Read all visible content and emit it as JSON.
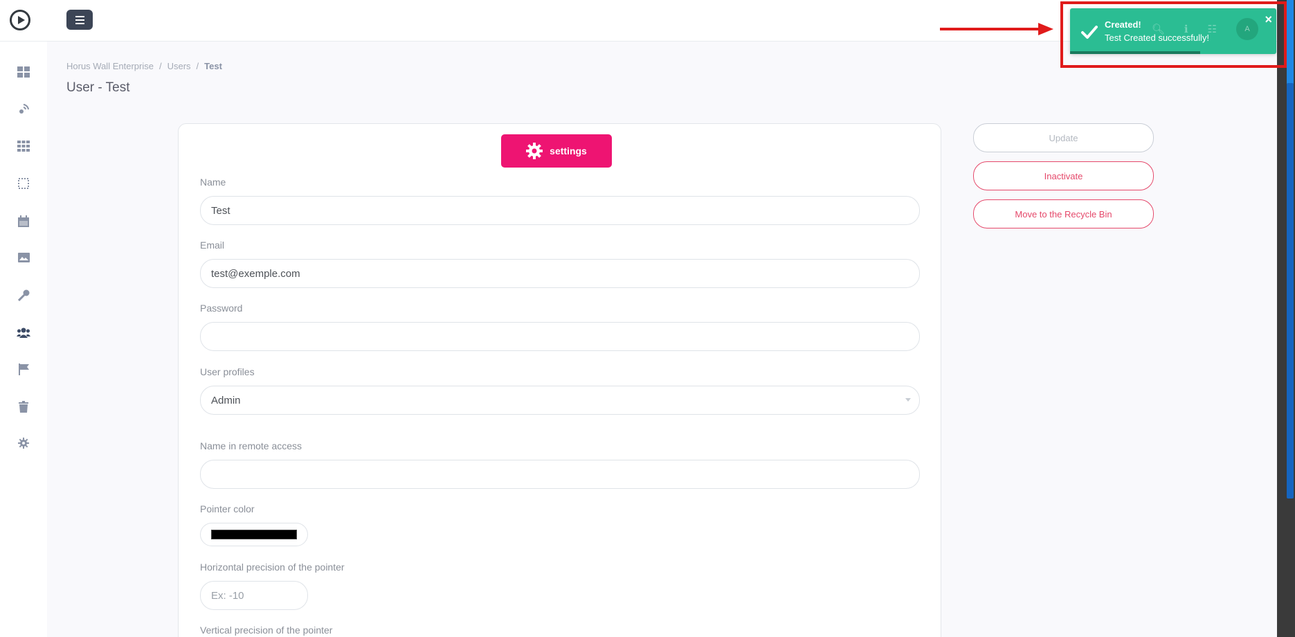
{
  "breadcrumb": {
    "org": "Horus Wall Enterprise",
    "section": "Users",
    "current": "Test",
    "separator": "/"
  },
  "page": {
    "title": "User - Test"
  },
  "topbar": {
    "avatar_initial": "A"
  },
  "sidebar": {
    "items": [
      {
        "icon": "dashboard-icon"
      },
      {
        "icon": "broadcast-icon"
      },
      {
        "icon": "apps-grid-icon"
      },
      {
        "icon": "layout-icon"
      },
      {
        "icon": "calendar-icon"
      },
      {
        "icon": "images-icon"
      },
      {
        "icon": "key-icon"
      },
      {
        "icon": "users-icon",
        "active": true
      },
      {
        "icon": "flag-icon"
      },
      {
        "icon": "trash-icon"
      },
      {
        "icon": "gear-icon"
      }
    ]
  },
  "form": {
    "settings_label": "settings",
    "name_label": "Name",
    "name_value": "Test",
    "email_label": "Email",
    "email_value": "test@exemple.com",
    "password_label": "Password",
    "password_value": "",
    "profiles_label": "User profiles",
    "profiles_value": "Admin",
    "remote_name_label": "Name in remote access",
    "remote_name_value": "",
    "pointer_color_label": "Pointer color",
    "pointer_color_value": "#000000",
    "h_precision_label": "Horizontal precision of the pointer",
    "h_precision_placeholder": "Ex: -10",
    "v_precision_label": "Vertical precision of the pointer"
  },
  "actions": {
    "update": "Update",
    "inactivate": "Inactivate",
    "recycle": "Move to the Recycle Bin"
  },
  "toast": {
    "title": "Created!",
    "message": "Test Created successfully!",
    "close": "×",
    "progress": 0.63
  },
  "colors": {
    "accent": "#ee1472",
    "toast": "#2bbd93",
    "danger": "#e5486a",
    "annotation": "#e01b1b"
  }
}
